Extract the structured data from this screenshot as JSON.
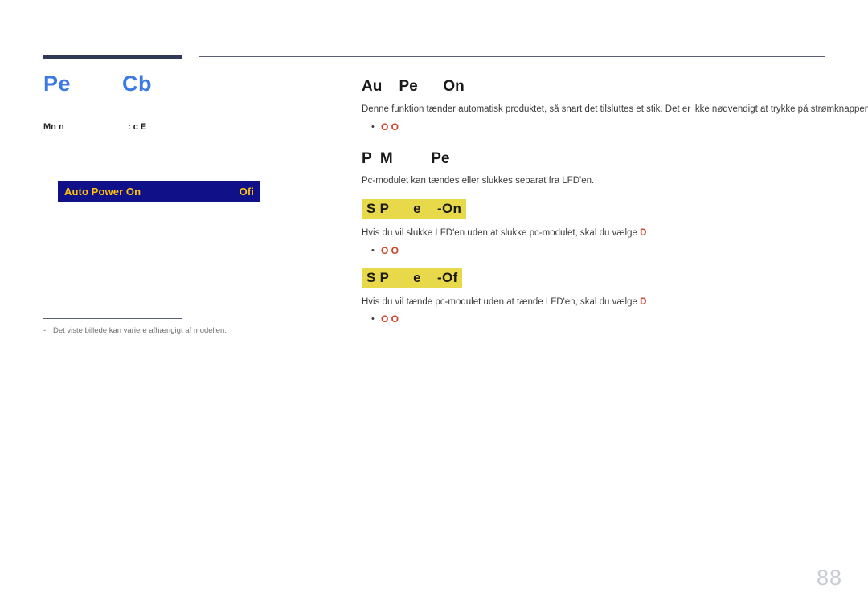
{
  "page": {
    "number": "88",
    "background_color": "#ffffff"
  },
  "rules": {
    "accent_bar_color": "#2e3a56",
    "thin_line_color": "#5a5f72"
  },
  "left_column": {
    "section_heading": "Pe        Cb",
    "section_heading_color": "#3b79e8",
    "menu_path_label": "Mn n",
    "menu_path_value": ": c E",
    "osd_screenshot": {
      "label": "Auto Power On",
      "value": "Ofi",
      "background_color": "#101089",
      "text_color": "#ffc20e"
    },
    "footnote": "Det viste billede kan variere afhængigt af modellen.",
    "footnote_dash": "-"
  },
  "right_column": {
    "sections": [
      {
        "heading": "Au    Pe      On",
        "paragraphs": [
          "Denne funktion tænder automatisk produktet, så snart det tilsluttes et stik. Det er ikke nødvendigt at trykke på strømknappen."
        ],
        "bullets": [
          {
            "dot": "•",
            "text": "O O"
          }
        ]
      },
      {
        "heading": "P  M         Pe",
        "paragraphs": [
          "Pc-modulet kan tændes eller slukkes separat fra LFD'en."
        ],
        "bullets": [],
        "subsections": [
          {
            "highlight_heading": "S P      e    -On",
            "highlight_color": "#e8d94a",
            "paragraph_prefix": "Hvis du vil slukke LFD'en uden at slukke pc-modulet, skal du vælge ",
            "paragraph_hot": "D",
            "bullets": [
              {
                "dot": "•",
                "text": "O O"
              }
            ]
          },
          {
            "highlight_heading": "S P      e    -Of",
            "highlight_color": "#e8d94a",
            "paragraph_prefix": "Hvis du vil tænde pc-modulet uden at tænde LFD'en, skal du vælge ",
            "paragraph_hot": "D",
            "bullets": [
              {
                "dot": "•",
                "text": "O O"
              }
            ]
          }
        ]
      }
    ]
  }
}
